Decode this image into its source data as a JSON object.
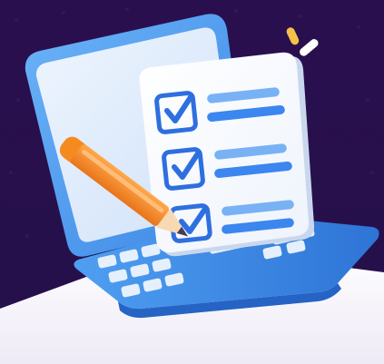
{
  "illustration": {
    "checklist_items": [
      {
        "checked": true
      },
      {
        "checked": true
      },
      {
        "checked": true
      }
    ],
    "icons": {
      "laptop": "laptop-icon",
      "checklist": "checklist-icon",
      "pencil": "pencil-icon",
      "sparkle": "sparkle-icon"
    },
    "colors": {
      "background_top": "#2a0f4e",
      "background_bottom": "#f3f1f8",
      "laptop_frame": "#4a9cf0",
      "laptop_frame_dark": "#2f6fd0",
      "screen": "#dce9fb",
      "paper": "#ffffff",
      "check_blue": "#2e6fe0",
      "line_blue": "#3b86ef",
      "pencil_orange": "#f58a1f",
      "pencil_tip": "#f7d9b4",
      "sparkle_yellow": "#f6c04a",
      "sparkle_white": "#ffffff"
    }
  }
}
